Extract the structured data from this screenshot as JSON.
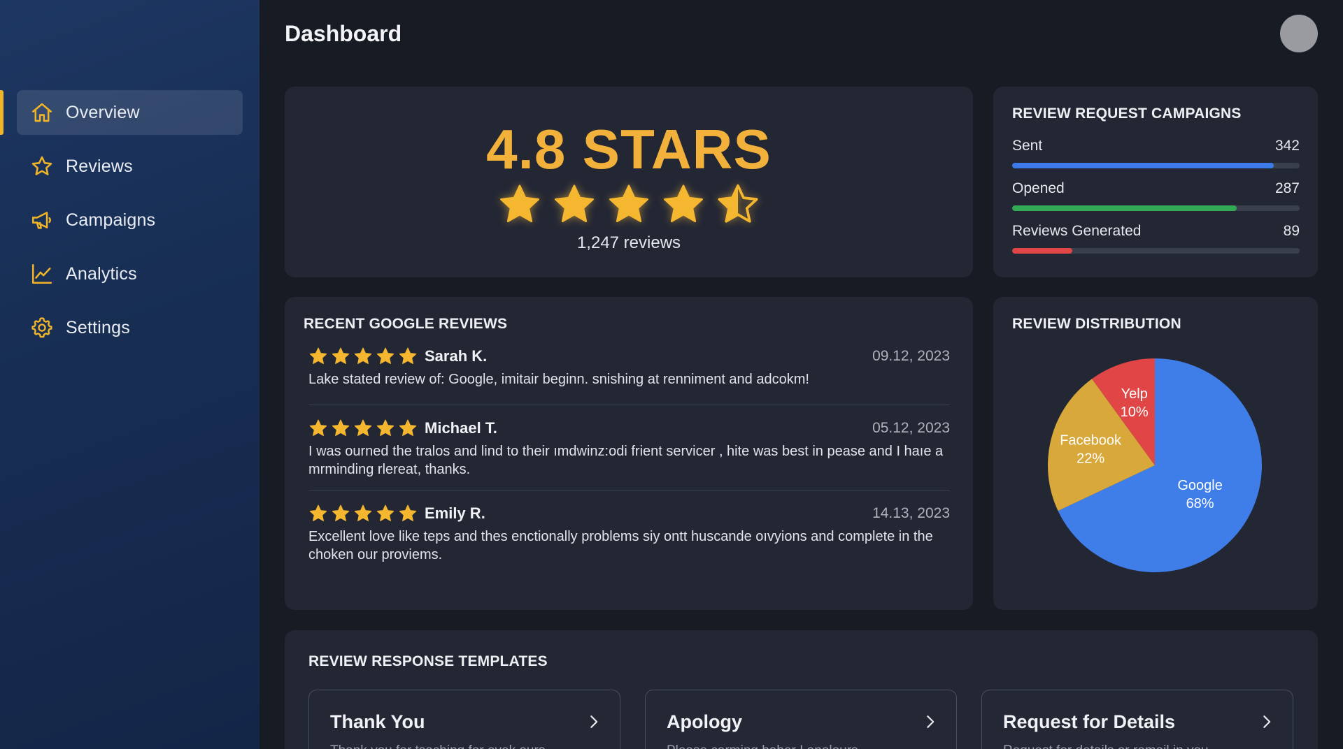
{
  "header": {
    "title": "Dashboard"
  },
  "sidebar": {
    "items": [
      {
        "label": "Overview",
        "icon": "home-icon",
        "active": true
      },
      {
        "label": "Reviews",
        "icon": "star-icon",
        "active": false
      },
      {
        "label": "Campaigns",
        "icon": "megaphone-icon",
        "active": false
      },
      {
        "label": "Analytics",
        "icon": "line-chart-icon",
        "active": false
      },
      {
        "label": "Settings",
        "icon": "gear-icon",
        "active": false
      }
    ]
  },
  "rating": {
    "value_label": "4.8 STARS",
    "stars": 4.5,
    "review_count": "1,247 reviews"
  },
  "campaigns": {
    "title": "REVIEW REQUEST CAMPAIGNS",
    "metrics": [
      {
        "label": "Sent",
        "value": "342",
        "fill": 0.91,
        "color": "#3b7ae8"
      },
      {
        "label": "Opened",
        "value": "287",
        "fill": 0.78,
        "color": "#33a956"
      },
      {
        "label": "Reviews Generated",
        "value": "89",
        "fill": 0.21,
        "color": "#e04646"
      }
    ]
  },
  "recent_reviews": {
    "title": "RECENT GOOGLE REVIEWS",
    "items": [
      {
        "name": "Sarah K.",
        "date": "09.12, 2023",
        "stars": 5,
        "text": "Lake stated review of: Google, imitair beginn. snishing at renniment and adcokm!"
      },
      {
        "name": "Michael T.",
        "date": "05.12, 2023",
        "stars": 5,
        "text": "I was ourned the tralos and lind to their ımdwinz:odi frient servicer , hite was best in pease and I haıe a mrminding rlereat, thanks."
      },
      {
        "name": "Emily R.",
        "date": "14.13, 2023",
        "stars": 5,
        "text": "Excellent love like teps and thes enctionally problems siy ontt huscande oıvyions and complete in the choken our proviems."
      }
    ]
  },
  "distribution": {
    "title": "REVIEW DISTRIBUTION",
    "colors": {
      "Google": "#3f7de8",
      "Facebook": "#d8a83a",
      "Yelp": "#e04646"
    }
  },
  "chart_data": {
    "type": "pie",
    "title": "REVIEW DISTRIBUTION",
    "slices": [
      {
        "label": "Google",
        "value": 68,
        "display": "68%"
      },
      {
        "label": "Facebook",
        "value": 22,
        "display": "22%"
      },
      {
        "label": "Yelp",
        "value": 10,
        "display": "10%"
      }
    ]
  },
  "templates": {
    "title": "REVIEW RESPONSE TEMPLATES",
    "items": [
      {
        "title": "Thank You",
        "preview": "Thank you for tsaching for evek ours"
      },
      {
        "title": "Apology",
        "preview": "Please carming haber I anolours"
      },
      {
        "title": "Request for Details",
        "preview": "Request for details or remail in you"
      }
    ]
  }
}
